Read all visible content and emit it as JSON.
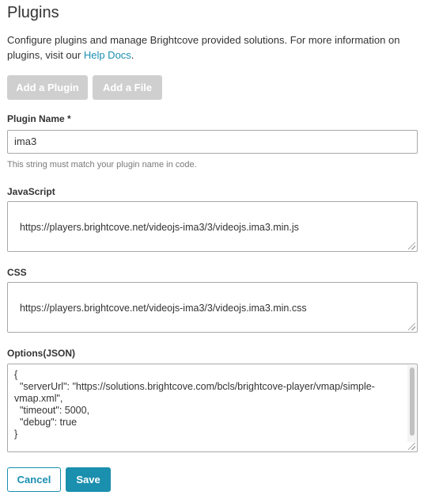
{
  "page": {
    "title": "Plugins",
    "intro_text": "Configure plugins and manage Brightcove provided solutions. For more information on plugins, visit our ",
    "intro_link": "Help Docs",
    "intro_end": "."
  },
  "toolbar": {
    "add_plugin_label": "Add a Plugin",
    "add_file_label": "Add a File"
  },
  "form": {
    "plugin_name": {
      "label": "Plugin Name *",
      "value": "ima3",
      "hint": "This string must match your plugin name in code."
    },
    "javascript": {
      "label": "JavaScript",
      "value": "https://players.brightcove.net/videojs-ima3/3/videojs.ima3.min.js"
    },
    "css": {
      "label": "CSS",
      "value": "https://players.brightcove.net/videojs-ima3/3/videojs.ima3.min.css"
    },
    "options": {
      "label": "Options(JSON)",
      "value": "{\n  \"serverUrl\": \"https://solutions.brightcove.com/bcls/brightcove-player/vmap/simple-vmap.xml\",\n  \"timeout\": 5000,\n  \"debug\": true\n}"
    }
  },
  "actions": {
    "cancel_label": "Cancel",
    "save_label": "Save"
  },
  "colors": {
    "accent": "#1b8fae",
    "disabled_button": "#cfcfcf"
  }
}
